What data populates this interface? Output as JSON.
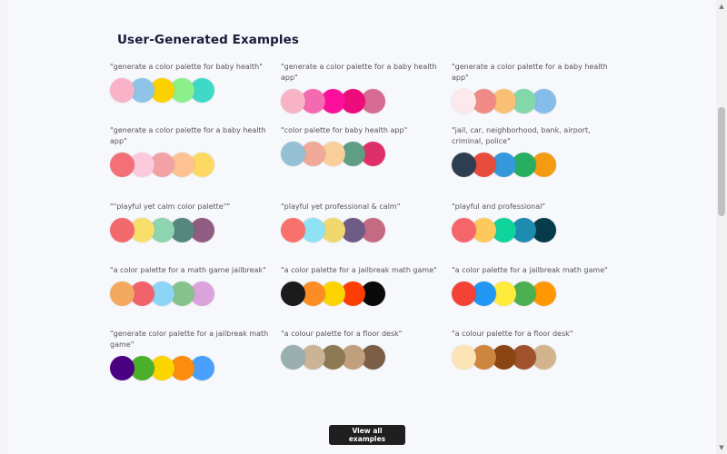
{
  "section": {
    "title": "User-Generated Examples",
    "view_all_label": "View all examples"
  },
  "examples": [
    {
      "label": "\"generate a color palette for baby health\"",
      "colors": [
        "#f9b3c8",
        "#8ec4e8",
        "#fdd000",
        "#8cf08a",
        "#3fd9c8"
      ]
    },
    {
      "label": "\"generate a color palette for a baby health app\"",
      "colors": [
        "#f8b3c6",
        "#f569b0",
        "#fc0f9a",
        "#ee0b7c",
        "#d86b94"
      ]
    },
    {
      "label": "\"generate a color palette for a baby health app\"",
      "colors": [
        "#fbe9ec",
        "#f08a86",
        "#f9bf74",
        "#82d8a8",
        "#86bce8"
      ]
    },
    {
      "label": "\"generate a color palette for a baby health app\"",
      "colors": [
        "#f27076",
        "#fbc9dc",
        "#f4a1a6",
        "#fcc292",
        "#fdd862"
      ]
    },
    {
      "label": "\"color palette for baby health app\"",
      "colors": [
        "#95bfd2",
        "#f0a898",
        "#f8ce9a",
        "#5e9e84",
        "#df2f6b"
      ]
    },
    {
      "label": "\"jail, car, neighborhood, bank, airport, criminal, police\"",
      "colors": [
        "#2c3e50",
        "#e74c3c",
        "#3498db",
        "#27ae60",
        "#f39c12"
      ]
    },
    {
      "label": "\"\"playful yet calm color palette\"\"",
      "colors": [
        "#f2696c",
        "#f8df6c",
        "#8fd4b0",
        "#56877f",
        "#905c81"
      ]
    },
    {
      "label": "\"playful yet professional & calm\"",
      "colors": [
        "#f8716c",
        "#8fe2f4",
        "#f0d86e",
        "#6e5b86",
        "#c46a82"
      ]
    },
    {
      "label": "\"playful and professional\"",
      "colors": [
        "#f5666c",
        "#fdc95c",
        "#0fd49c",
        "#1d8cb0",
        "#073b4c"
      ]
    },
    {
      "label": "\"a color palette for a math game jailbreak\"",
      "colors": [
        "#f2a85e",
        "#f0636a",
        "#8cd5f4",
        "#84c48c",
        "#dca2dc"
      ]
    },
    {
      "label": "\"a color palette for a jailbreak math game\"",
      "colors": [
        "#1b1b1b",
        "#fc8c24",
        "#fcd400",
        "#fc3d04",
        "#0a0a0a"
      ]
    },
    {
      "label": "\"a color palette for a jailbreak math game\"",
      "colors": [
        "#f44336",
        "#2196f3",
        "#ffeb3b",
        "#4caf50",
        "#ff9800"
      ]
    },
    {
      "label": "\"generate color palette for a jailbreak math game\"",
      "colors": [
        "#4b0082",
        "#4caf2c",
        "#fcd400",
        "#fc8c0c",
        "#48a0fc"
      ]
    },
    {
      "label": "\"a colour palette for a floor desk\"",
      "colors": [
        "#99aeae",
        "#cbb496",
        "#8d7a54",
        "#c19f7c",
        "#7b5e45"
      ]
    },
    {
      "label": "\"a colour palette for a floor desk\"",
      "colors": [
        "#fde4b6",
        "#cd853f",
        "#8b4513",
        "#a0522d",
        "#d2b48c"
      ]
    }
  ],
  "icons": {
    "scroll_up": "up-arrow",
    "scroll_down": "down-arrow"
  }
}
